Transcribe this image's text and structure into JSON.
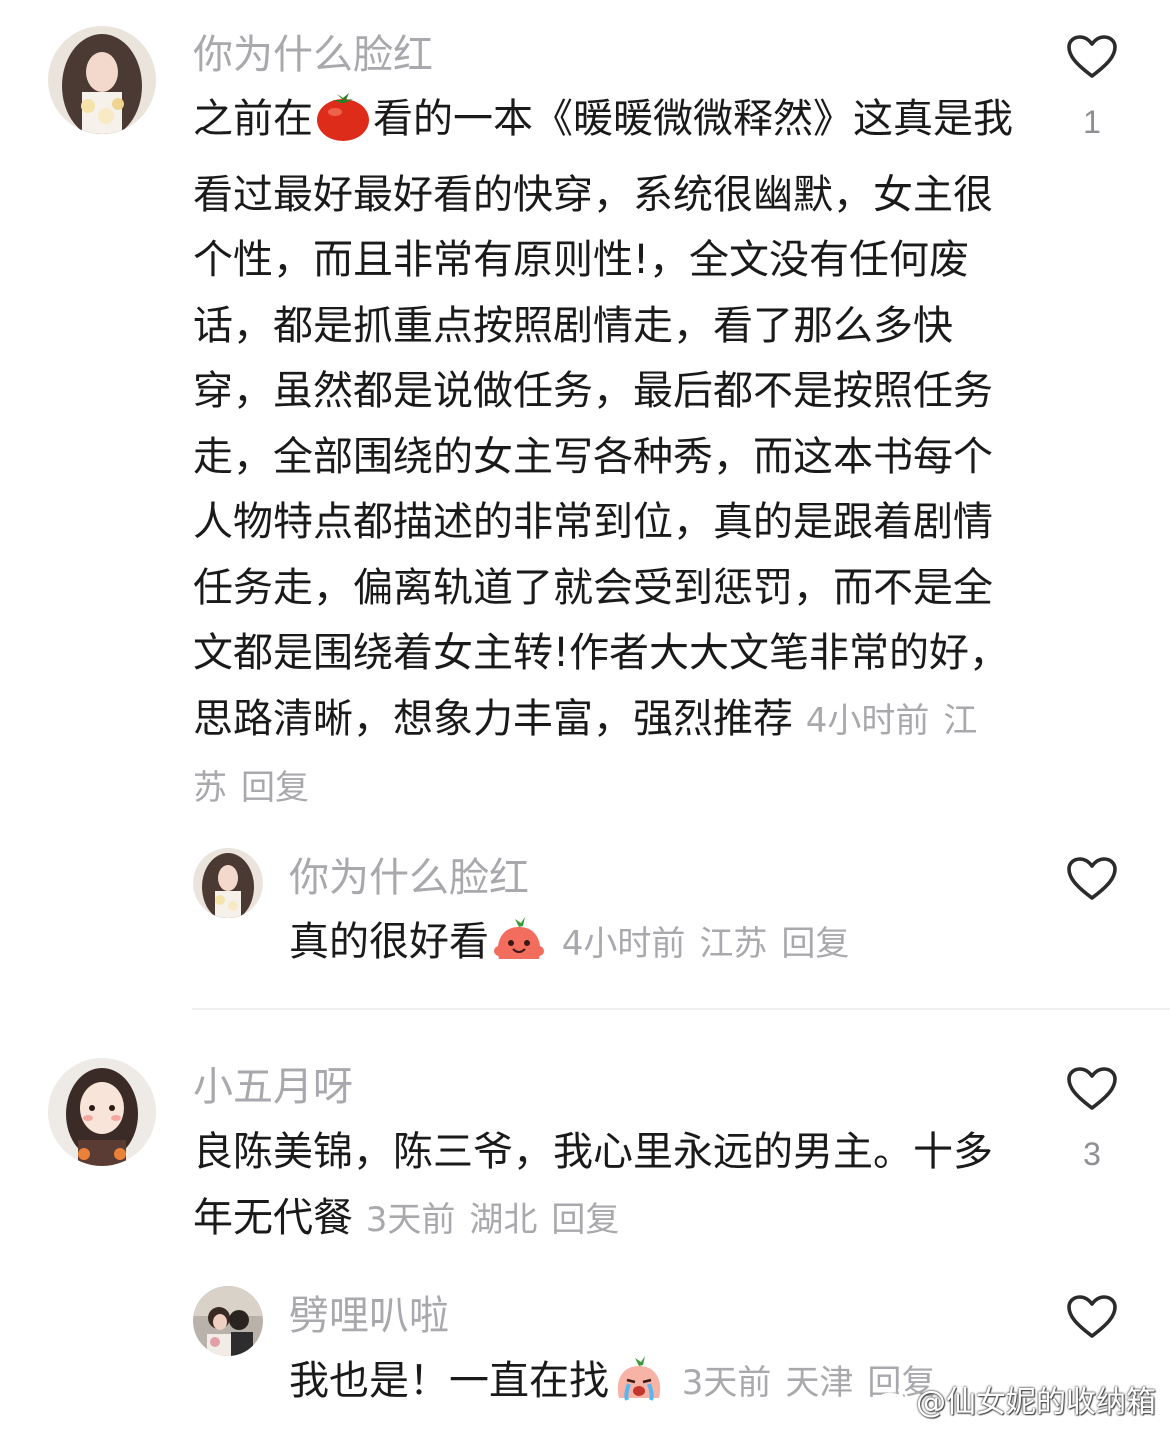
{
  "comment1": {
    "username": "你为什么脸红",
    "text_prefix": "之前在",
    "text_body": "看的一本《暖暖微微释然》这真是我看过最好最好看的快穿，系统很幽默，女主很个性，而且非常有原则性!，全文没有任何废话，都是抓重点按照剧情走，看了那么多快穿，虽然都是说做任务，最后都不是按照任务走，全部围绕的女主写各种秀，而这本书每个人物特点都描述的非常到位，真的是跟着剧情任务走，偏离轨道了就会受到惩罚，而不是全文都是围绕着女主转!作者大大文笔非常的好，思路清晰，想象力丰富，强烈推荐",
    "inline_icon": "tomato-icon",
    "time": "4小时前",
    "location": "江苏",
    "reply_label": "回复",
    "like_count": "1"
  },
  "reply1": {
    "username": "你为什么脸红",
    "text": "真的很好看",
    "inline_icon": "happy-peach-emoji",
    "time": "4小时前",
    "location": "江苏",
    "reply_label": "回复",
    "like_count": ""
  },
  "comment2": {
    "username": "小五月呀",
    "text": "良陈美锦，陈三爷，我心里永远的男主。十多年无代餐",
    "time": "3天前",
    "location": "湖北",
    "reply_label": "回复",
    "like_count": "3"
  },
  "reply2": {
    "username": "劈哩叭啦",
    "text": "我也是！一直在找",
    "inline_icon": "crying-peach-emoji",
    "time": "3天前",
    "location": "天津",
    "reply_label": "回复",
    "like_count": ""
  },
  "watermark": "@仙女妮的收纳箱",
  "colors": {
    "text": "#1a1a1a",
    "meta": "#a9a9ad",
    "heart_outline": "#2b2b2b",
    "divider": "#f0f0f0"
  }
}
